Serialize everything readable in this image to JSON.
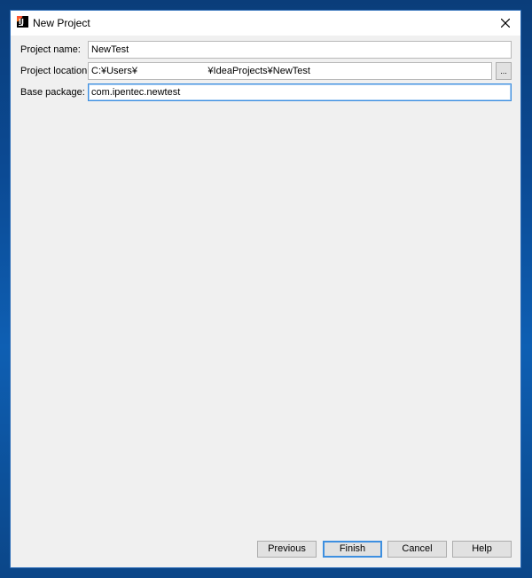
{
  "window": {
    "title": "New Project",
    "app_icon_text": "IJ"
  },
  "form": {
    "project_name": {
      "label": "Project name:",
      "value": "NewTest"
    },
    "project_location": {
      "label": "Project location:",
      "value": "C:¥Users¥                          ¥IdeaProjects¥NewTest",
      "browse_label": "..."
    },
    "base_package": {
      "label": "Base package:",
      "value": "com.ipentec.newtest"
    }
  },
  "buttons": {
    "previous": "Previous",
    "finish": "Finish",
    "cancel": "Cancel",
    "help": "Help"
  },
  "colors": {
    "focus_accent": "#3d8fe0",
    "desktop_background": "#0b4a94",
    "dialog_background": "#f0f0f0"
  }
}
